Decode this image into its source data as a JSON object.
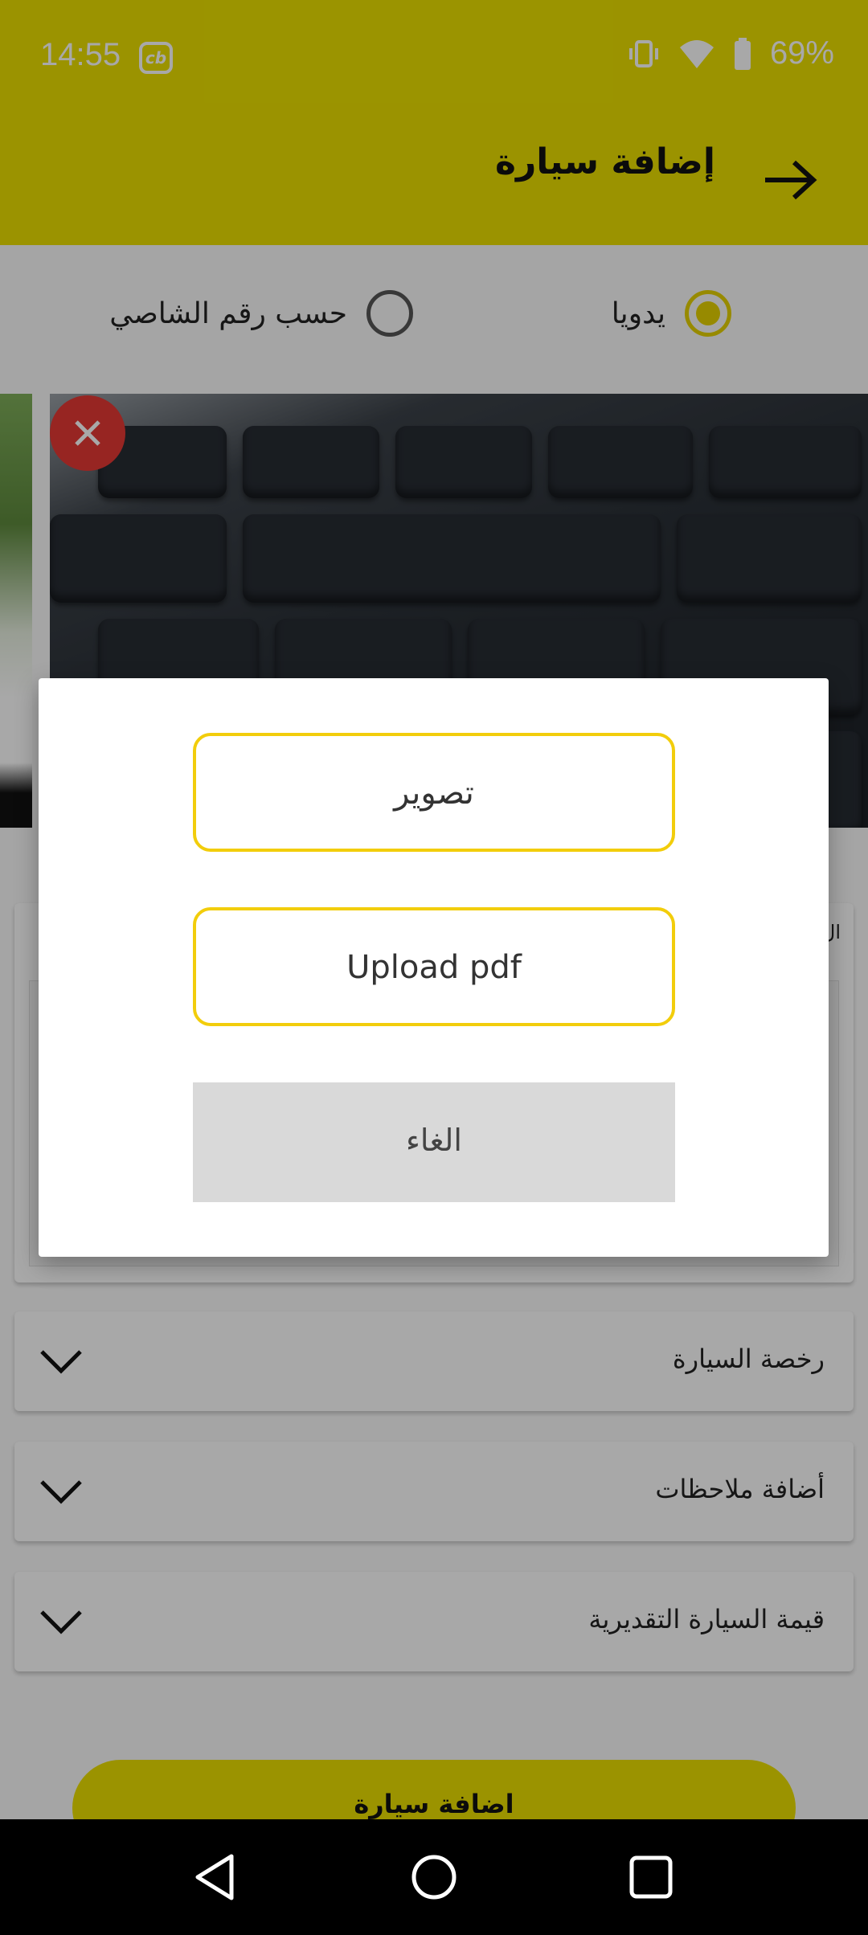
{
  "status": {
    "time": "14:55",
    "battery": "69%"
  },
  "header": {
    "title": "إضافة سيارة"
  },
  "mode": {
    "manual_label": "يدويا",
    "chassis_label": "حسب رقم الشاصي"
  },
  "sections": [
    {
      "label": "رخصة السيارة"
    },
    {
      "label": "أضافة ملاحظات"
    },
    {
      "label": "قيمة السيارة التقديرية"
    }
  ],
  "partial_card_label": "ال",
  "submit": {
    "label": "اضافة سيارة"
  },
  "dialog": {
    "capture_label": "تصوير",
    "upload_label": "Upload pdf",
    "cancel_label": "الغاء"
  },
  "colors": {
    "accent": "#ece000",
    "dialog_border": "#f2cd0b",
    "delete": "#e53935"
  }
}
